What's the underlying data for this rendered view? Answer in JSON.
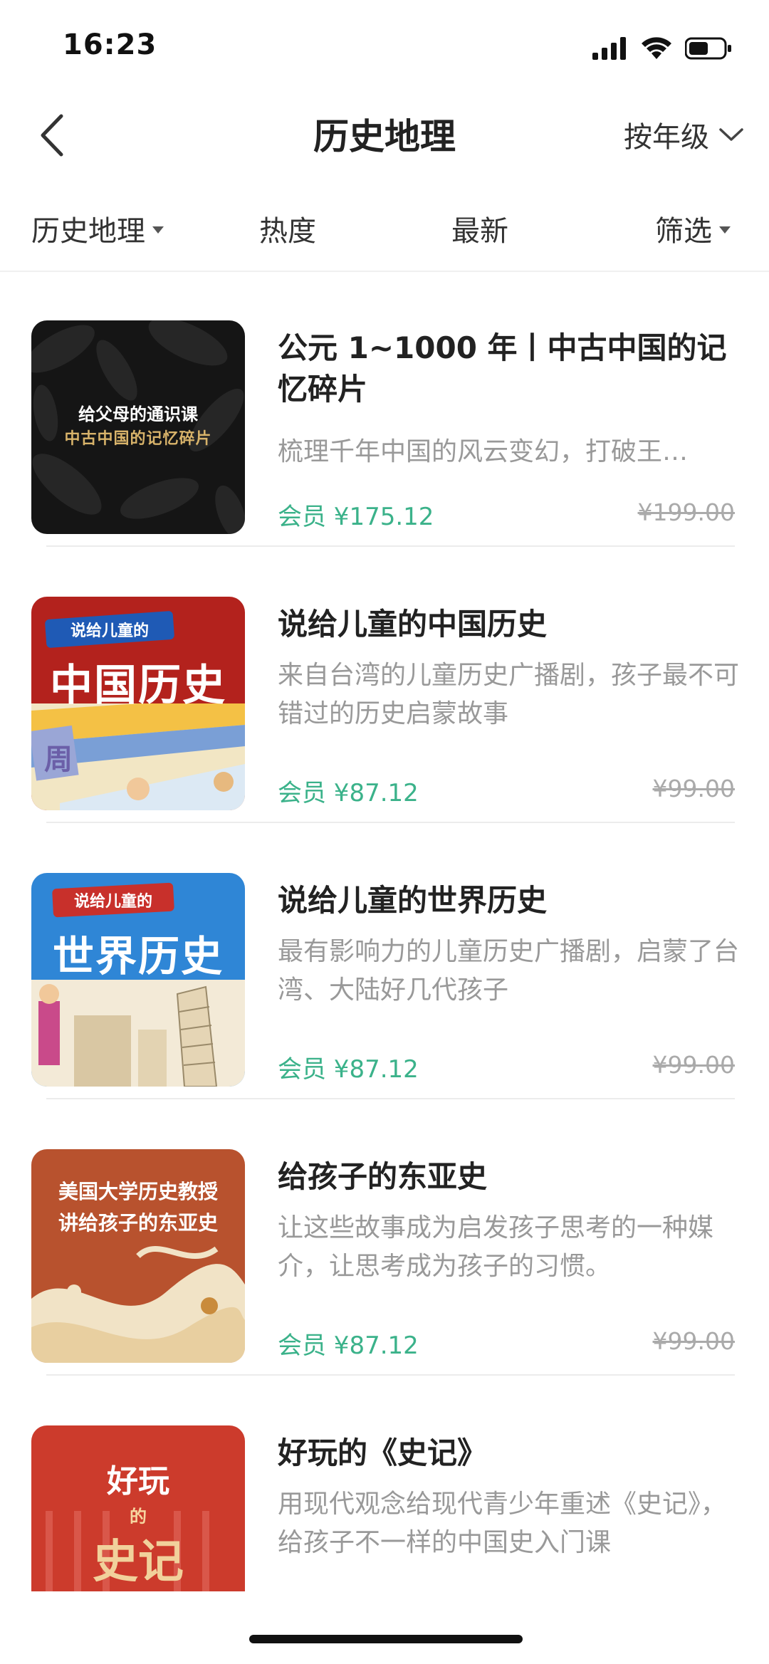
{
  "status": {
    "time": "16:23"
  },
  "nav": {
    "title": "历史地理",
    "grade_select": "按年级"
  },
  "filters": [
    {
      "label": "历史地理"
    },
    {
      "label": "热度"
    },
    {
      "label": "最新"
    },
    {
      "label": "筛选"
    }
  ],
  "courses": [
    {
      "title": "公元 1~1000 年丨中古中国的记忆碎片",
      "desc": "梳理千年中国的风云变幻，打破王…",
      "price": "会员 ¥175.12",
      "orig": "¥199.00",
      "cover": {
        "line1": "给父母的通识课",
        "line2": "中古中国的记忆碎片"
      }
    },
    {
      "title": "说给儿童的中国历史",
      "desc": "来自台湾的儿童历史广播剧，孩子最不可错过的历史启蒙故事",
      "price": "会员 ¥87.12",
      "orig": "¥99.00",
      "cover": {
        "ribbon": "说给儿童的",
        "big": "中国历史",
        "seal": "周"
      }
    },
    {
      "title": "说给儿童的世界历史",
      "desc": "最有影响力的儿童历史广播剧，启蒙了台湾、大陆好几代孩子",
      "price": "会员 ¥87.12",
      "orig": "¥99.00",
      "cover": {
        "ribbon": "说给儿童的",
        "big": "世界历史"
      }
    },
    {
      "title": "给孩子的东亚史",
      "desc": "让这些故事成为启发孩子思考的一种媒介，让思考成为孩子的习惯。",
      "price": "会员 ¥87.12",
      "orig": "¥99.00",
      "cover": {
        "line1": "美国大学历史教授",
        "line2": "讲给孩子的东亚史"
      }
    },
    {
      "title": "好玩的《史记》",
      "desc": "用现代观念给现代青少年重述《史记》，给孩子不一样的中国史入门课",
      "price": "",
      "orig": "",
      "cover": {
        "line1": "好玩",
        "line2": "的",
        "line3": "史记"
      }
    }
  ]
}
